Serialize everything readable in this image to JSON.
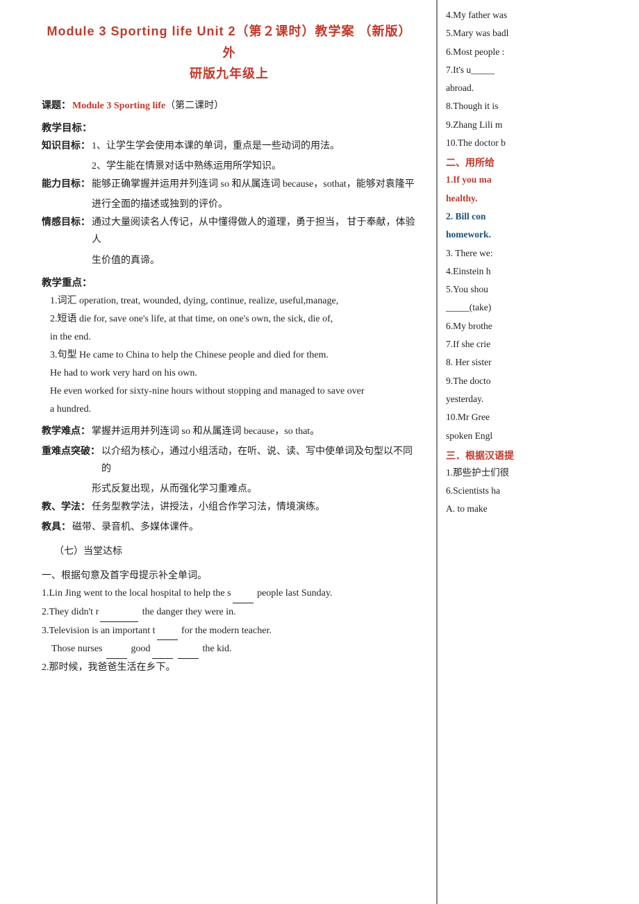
{
  "document": {
    "title_line1": "Module 3 Sporting life  Unit 2（第２课时）教学案 （新版）外",
    "title_line2": "研版九年级上"
  },
  "main": {
    "subject_label": "课题：",
    "subject_red": "Module 3 Sporting life",
    "subject_rest": "（第二课时）",
    "teaching_goals_label": "教学目标：",
    "knowledge_label": "知识目标：",
    "knowledge_1": "1、让学生学会使用本课的单词，重点是一些动词的用法。",
    "knowledge_2": "2、学生能在情景对话中熟练运用所学知识。",
    "ability_label": "能力目标：",
    "ability_1": "能够正确掌握并运用并列连词 so 和从属连词 because，sothat，能够对袁隆平",
    "ability_2": "进行全面的描述或独到的评价。",
    "emotion_label": "情感目标：",
    "emotion_1": "通过大量阅读名人传记，从中懂得做人的道理，勇于担当，  甘于奉献，体验人",
    "emotion_2": "生价值的真谛。",
    "key_points_label": "教学重点：",
    "key_points_1": "1.词汇 operation, treat, wounded, dying, continue, realize, useful,manage,",
    "key_points_2": "2.短语 die for, save one's life, at that time, on one's own, the sick, die of,",
    "key_points_3": "         in the end.",
    "key_points_4": "3.句型 He came to China to help the Chinese people and died for them.",
    "key_points_5": "        He had to work very hard on his own.",
    "key_points_6": "        He even worked for sixty-nine hours without stopping and managed to save over",
    "key_points_7": "        a hundred.",
    "difficulty_label": "教学难点：",
    "difficulty_1": "掌握并运用并列连词 so 和从属连词 because，so that。",
    "breakthrough_label": "重难点突破：",
    "breakthrough_1": "以介绍为核心，通过小组活动，在听、说、读、写中使单词及句型以不同的",
    "breakthrough_2": "          形式反复出现，从而强化学习重难点。",
    "method_label": "教、学法：",
    "method_1": "任务型教学法，讲授法，小组合作学习法，情境演练。",
    "tools_label": "教具：",
    "tools_1": "磁带、录音机、多媒体课件。",
    "subsection": "（七）当堂达标",
    "exercise_intro": "一、根据句意及首字母提示补全单词。",
    "ex1": "1.Lin Jing went to the local hospital to help the s",
    "ex1_blank": "____",
    "ex1_rest": " people last Sunday.",
    "ex2": "2.They didn't r",
    "ex2_blank": "________",
    "ex2_rest": " the danger they were in.",
    "ex3": "3.Television is an important t",
    "ex3_blank": "_____",
    "ex3_rest": " for the modern teacher.",
    "ex4_label": " Those nurses ",
    "ex4_blank1": "_____",
    "ex4_mid": " good",
    "ex4_blank2": "_____",
    "ex4_blank3": " _____",
    "ex4_rest": " the kid.",
    "ex5": "2.那时候，我爸爸生活在乡下。"
  },
  "sidebar": {
    "items": [
      "4.My father was",
      "5.Mary was badl",
      "6.Most people :",
      "7.It's u_____",
      "abroad.",
      "8.Though it is",
      "9.Zhang Lili m",
      "10.The doctor b"
    ],
    "section2_title": "二、用所给",
    "section2_items": [
      "1.If you ma",
      "healthy.",
      "2. Bill con",
      "homework.",
      "3. There we:",
      "4.Einstein h",
      "5.You shou",
      "_____(take)",
      "6.My brothe",
      "7.If she crie",
      "8. Her sister",
      "9.The docto",
      "yesterday.",
      "10.Mr Gree",
      "spoken Engl"
    ],
    "section3_title": "三．根据汉语提",
    "section3_items": [
      "1.那些护士们很",
      "6.Scientists ha",
      "  A. to make"
    ]
  }
}
